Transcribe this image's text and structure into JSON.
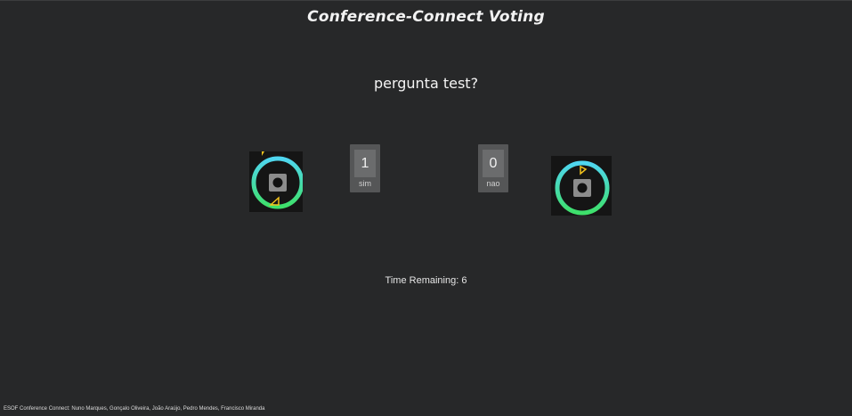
{
  "header": {
    "title": "Conference-Connect Voting"
  },
  "question": {
    "text": "pergunta test?"
  },
  "options": [
    {
      "label": "sim",
      "count": "1"
    },
    {
      "label": "nao",
      "count": "0"
    }
  ],
  "markers": [
    {
      "icon": "marker-ring-icon",
      "ring_colors": [
        "#4fd6f0",
        "#3ee06a"
      ],
      "accent": "#f2c21b"
    },
    {
      "icon": "marker-ring-icon",
      "ring_colors": [
        "#4fd6f0",
        "#3ee06a"
      ],
      "accent": "#f2c21b"
    }
  ],
  "timer": {
    "text": "Time Remaining: 6"
  },
  "footer": {
    "credits": "ESOF Conference Connect: Nuno Marques, Gonçalo Oliveira, João Araújo, Pedro Mendes, Francisco Miranda"
  }
}
